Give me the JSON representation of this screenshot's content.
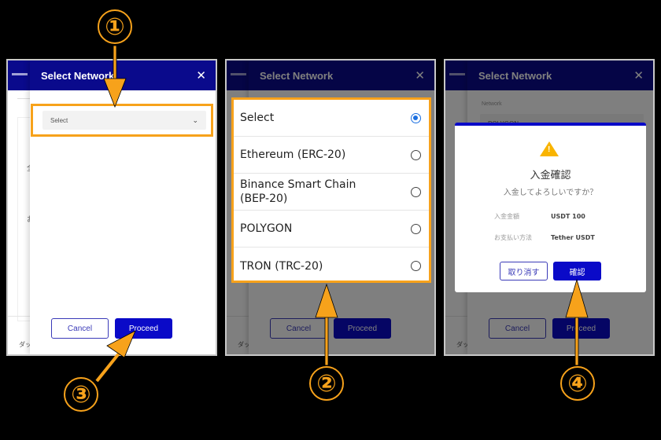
{
  "steps": [
    "①",
    "②",
    "③",
    "④"
  ],
  "colors": {
    "accent": "#f7a21b",
    "header": "#0a0a8c",
    "primary": "#0a0ac8",
    "radio": "#1a6fe0",
    "warning": "#f9b400"
  },
  "modal": {
    "title": "Select Network",
    "network_label": "Network",
    "select_value": "Select",
    "cancel_label": "Cancel",
    "proceed_label": "Proceed"
  },
  "background": {
    "footer_text": "ダッ",
    "jp_fragment_1": "全",
    "jp_fragment_2": "お"
  },
  "network_options": [
    {
      "label": "Select",
      "selected": true
    },
    {
      "label": "Ethereum (ERC-20)",
      "selected": false
    },
    {
      "label": "Binance Smart Chain (BEP-20)",
      "selected": false
    },
    {
      "label": "POLYGON",
      "selected": false
    },
    {
      "label": "TRON (TRC-20)",
      "selected": false
    }
  ],
  "panel3": {
    "selected_network": "POLYGON"
  },
  "confirm_dialog": {
    "title": "入金確認",
    "subtitle": "入金してよろしいですか？",
    "rows": [
      {
        "key": "入金金額",
        "value": "USDT 100"
      },
      {
        "key": "お支払い方法",
        "value": "Tether USDT"
      }
    ],
    "cancel_label": "取り消す",
    "confirm_label": "確認"
  }
}
